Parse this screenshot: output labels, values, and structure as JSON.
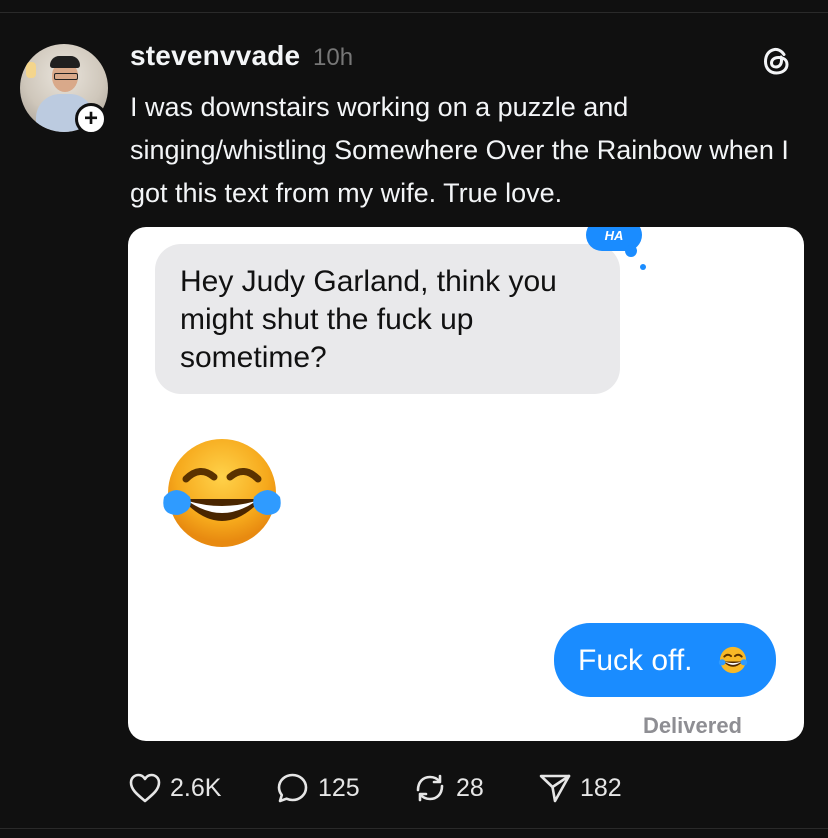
{
  "post": {
    "username": "stevenvvade",
    "timestamp": "10h",
    "follow_symbol": "+",
    "text": "I was downstairs working on a puzzle and singing/whistling Somewhere Over the Rainbow when I got this text from my wife. True love."
  },
  "attachment": {
    "incoming_message": "Hey Judy Garland, think you might shut the fuck up sometime?",
    "tapback_label": "HA",
    "outgoing_message": "Fuck off.",
    "delivery_status": "Delivered",
    "emoji": "face-with-tears-of-joy"
  },
  "actions": {
    "likes": "2.6K",
    "replies": "125",
    "reposts": "28",
    "shares": "182"
  },
  "icons": {
    "brand": "threads-logo",
    "like": "heart-icon",
    "reply": "speech-bubble-icon",
    "repost": "repost-icon",
    "share": "paper-plane-icon"
  },
  "colors": {
    "background": "#101010",
    "imessage_blue": "#1a8cff",
    "incoming_bubble": "#e9e9eb",
    "muted_text": "#777777"
  }
}
